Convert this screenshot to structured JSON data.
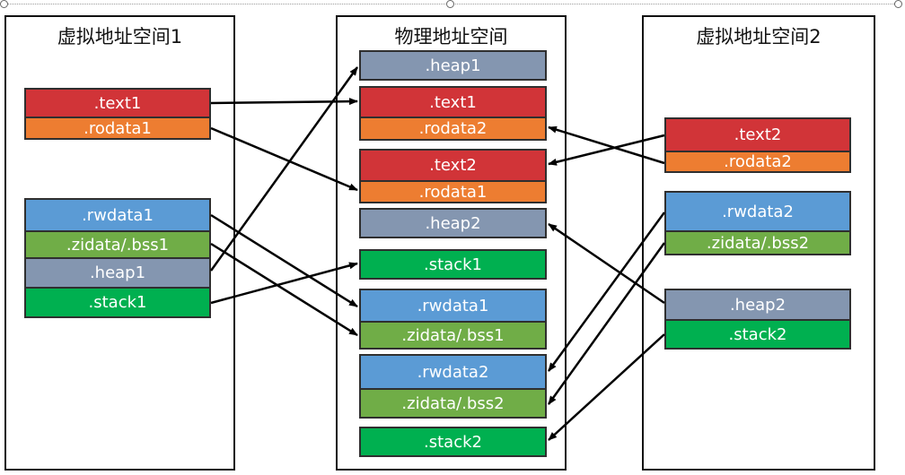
{
  "panels": {
    "virtual1_title": "虚拟地址空间1",
    "physical_title": "物理地址空间",
    "virtual2_title": "虚拟地址空间2"
  },
  "virtual1": {
    "text1": ".text1",
    "rodata1": ".rodata1",
    "rwdata1": ".rwdata1",
    "zidata1": ".zidata/.bss1",
    "heap1": ".heap1",
    "stack1": ".stack1"
  },
  "physical": {
    "heap1": ".heap1",
    "text1": ".text1",
    "rodata2": ".rodata2",
    "text2": ".text2",
    "rodata1": ".rodata1",
    "heap2": ".heap2",
    "stack1": ".stack1",
    "rwdata1": ".rwdata1",
    "zidata1": ".zidata/.bss1",
    "rwdata2": ".rwdata2",
    "zidata2": ".zidata/.bss2",
    "stack2": ".stack2"
  },
  "virtual2": {
    "text2": ".text2",
    "rodata2": ".rodata2",
    "rwdata2": ".rwdata2",
    "zidata2": ".zidata/.bss2",
    "heap2": ".heap2",
    "stack2": ".stack2"
  },
  "colors": {
    "text": "#d13438",
    "rodata": "#ed7d31",
    "rwdata": "#5b9bd5",
    "zidata": "#70ad47",
    "heap": "#8496b0",
    "stack": "#00b050",
    "arrow": "#000000"
  }
}
